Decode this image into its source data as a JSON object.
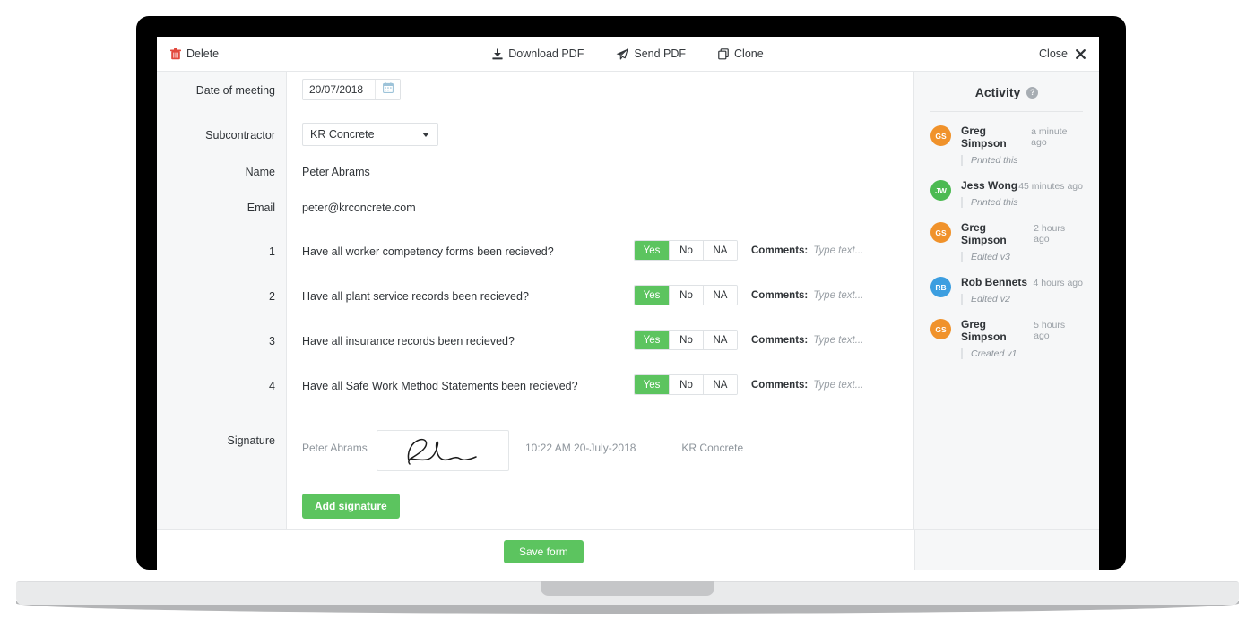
{
  "toolbar": {
    "delete_label": "Delete",
    "delete_icon": "trash-icon",
    "download_pdf_label": "Download PDF",
    "download_icon": "download-icon",
    "send_pdf_label": "Send PDF",
    "send_icon": "paper-plane-icon",
    "clone_label": "Clone",
    "clone_icon": "copy-icon",
    "close_label": "Close",
    "close_icon": "close-x-icon"
  },
  "form": {
    "date_label": "Date of meeting",
    "date_value": "20/07/2018",
    "date_picker_icon": "calendar-icon",
    "subcontractor_label": "Subcontractor",
    "subcontractor_value": "KR Concrete",
    "name_label": "Name",
    "name_value": "Peter Abrams",
    "email_label": "Email",
    "email_value": "peter@krconcrete.com",
    "comments_label": "Comments:",
    "comments_placeholder": "Type text...",
    "toggle_options": [
      "Yes",
      "No",
      "NA"
    ],
    "questions": [
      {
        "number": "1",
        "text": "Have all worker competency forms been recieved?",
        "answer": "Yes",
        "comment": ""
      },
      {
        "number": "2",
        "text": "Have all plant service records been recieved?",
        "answer": "Yes",
        "comment": ""
      },
      {
        "number": "3",
        "text": "Have all insurance records been recieved?",
        "answer": "Yes",
        "comment": ""
      },
      {
        "number": "4",
        "text": "Have all Safe Work Method Statements been recieved?",
        "answer": "Yes",
        "comment": ""
      }
    ],
    "signature_label": "Signature",
    "signature_name": "Peter Abrams",
    "signature_timestamp": "10:22 AM 20-July-2018",
    "signature_company": "KR Concrete",
    "add_signature_label": "Add signature",
    "save_label": "Save form"
  },
  "activity": {
    "title": "Activity",
    "help_icon": "question-mark-icon",
    "help_glyph": "?",
    "items": [
      {
        "initials": "GS",
        "name": "Greg Simpson",
        "time": "a minute ago",
        "action": "Printed this",
        "color": "#f0922b"
      },
      {
        "initials": "JW",
        "name": "Jess Wong",
        "time": "45 minutes ago",
        "action": "Printed this",
        "color": "#4cba52"
      },
      {
        "initials": "GS",
        "name": "Greg Simpson",
        "time": "2 hours ago",
        "action": "Edited v3",
        "color": "#f0922b"
      },
      {
        "initials": "RB",
        "name": "Rob Bennets",
        "time": "4 hours ago",
        "action": "Edited v2",
        "color": "#3c9ee0"
      },
      {
        "initials": "GS",
        "name": "Greg Simpson",
        "time": "5 hours ago",
        "action": "Created v1",
        "color": "#f0922b"
      }
    ]
  },
  "colors": {
    "accent_green": "#5cc45f",
    "delete_red": "#e2483d",
    "panel_bg": "#f6f7f8",
    "border": "#e6e8ea"
  }
}
